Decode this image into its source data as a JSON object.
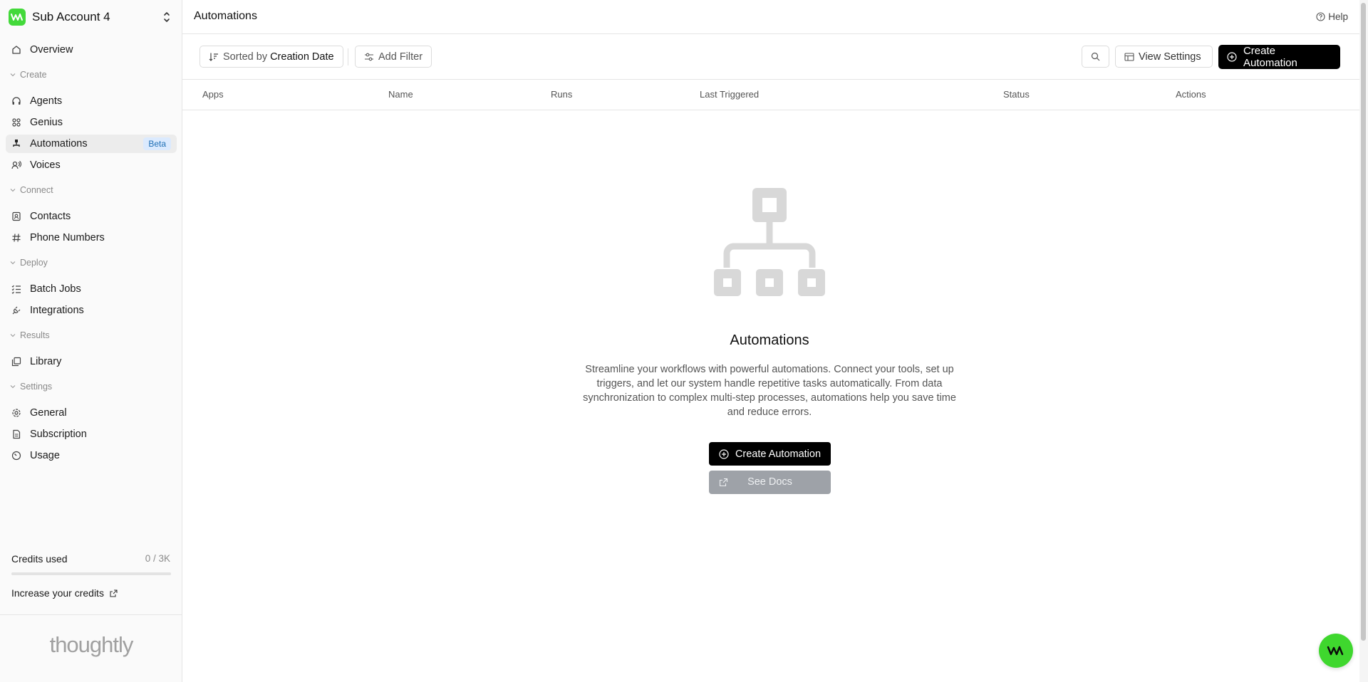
{
  "account": {
    "name": "Sub Account 4"
  },
  "sidebar": {
    "overview": "Overview",
    "sections": [
      {
        "label": "Create",
        "items": [
          {
            "label": "Agents",
            "icon": "headset-icon"
          },
          {
            "label": "Genius",
            "icon": "grid-icon"
          },
          {
            "label": "Automations",
            "icon": "flow-icon",
            "badge": "Beta",
            "active": true
          },
          {
            "label": "Voices",
            "icon": "voice-icon"
          }
        ]
      },
      {
        "label": "Connect",
        "items": [
          {
            "label": "Contacts",
            "icon": "contacts-icon"
          },
          {
            "label": "Phone Numbers",
            "icon": "hash-icon"
          }
        ]
      },
      {
        "label": "Deploy",
        "items": [
          {
            "label": "Batch Jobs",
            "icon": "list-check-icon"
          },
          {
            "label": "Integrations",
            "icon": "plug-icon"
          }
        ]
      },
      {
        "label": "Results",
        "items": [
          {
            "label": "Library",
            "icon": "library-icon"
          }
        ]
      },
      {
        "label": "Settings",
        "items": [
          {
            "label": "General",
            "icon": "gear-icon"
          },
          {
            "label": "Subscription",
            "icon": "document-icon"
          },
          {
            "label": "Usage",
            "icon": "gauge-icon"
          }
        ]
      }
    ],
    "credits": {
      "label": "Credits used",
      "value": "0 / 3K",
      "fraction": 0
    },
    "increase": "Increase your credits",
    "brand": "thoughtly"
  },
  "header": {
    "title": "Automations",
    "help": "Help"
  },
  "toolbar": {
    "sorted_by": "Sorted by",
    "sort_field": "Creation Date",
    "add_filter": "Add Filter",
    "view_settings": "View Settings",
    "create": "Create Automation"
  },
  "table": {
    "columns": [
      "Apps",
      "Name",
      "Runs",
      "Last Triggered",
      "Status",
      "Actions"
    ]
  },
  "empty": {
    "title": "Automations",
    "description": "Streamline your workflows with powerful automations. Connect your tools, set up triggers, and let our system handle repetitive tasks automatically. From data synchronization to complex multi-step processes, automations help you save time and reduce errors.",
    "create": "Create Automation",
    "docs": "See Docs"
  },
  "colors": {
    "brand_green": "#43d93a",
    "primary": "#000000",
    "badge_bg": "#dbeafe",
    "badge_text": "#1f6fb5"
  }
}
